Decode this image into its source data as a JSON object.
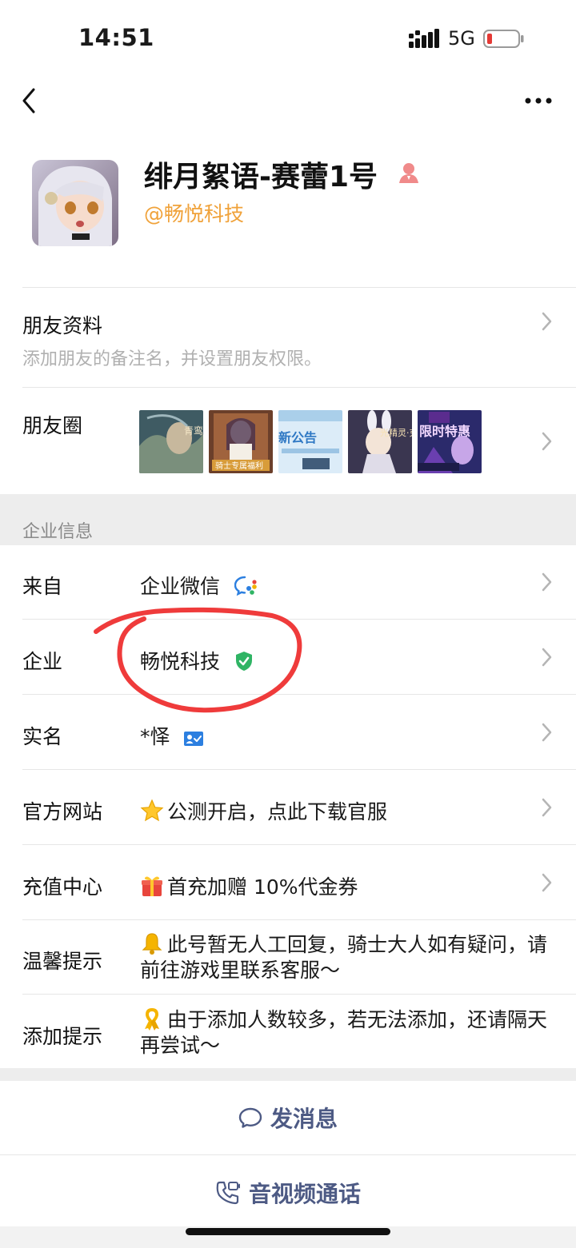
{
  "status_bar": {
    "time": "14:51",
    "network": "5G"
  },
  "profile": {
    "name": "绯月絮语-赛蕾1号",
    "company": "@畅悦科技"
  },
  "friend_info": {
    "title": "朋友资料",
    "subtitle": "添加朋友的备注名，并设置朋友权限。"
  },
  "moments": {
    "title": "朋友圈",
    "thumbnails": [
      "青鸾",
      "骑士专属福利",
      "新公告",
      "光精灵·克",
      "限时特惠"
    ]
  },
  "enterprise": {
    "section_title": "企业信息",
    "rows": [
      {
        "label": "来自",
        "value": "企业微信"
      },
      {
        "label": "企业",
        "value": "畅悦科技"
      },
      {
        "label": "实名",
        "value": "*怿"
      },
      {
        "label": "官方网站",
        "value": "公测开启，点此下载官服",
        "emoji": "star-icon"
      },
      {
        "label": "充值中心",
        "value": "首充加赠 10%代金券",
        "emoji": "gift-icon"
      },
      {
        "label": "温馨提示",
        "value": "此号暂无人工回复，骑士大人如有疑问，请前往游戏里联系客服～",
        "emoji": "bell-icon"
      },
      {
        "label": "添加提示",
        "value": "由于添加人数较多，若无法添加，还请隔天再尝试～",
        "emoji": "ribbon-icon"
      }
    ]
  },
  "actions": {
    "message": "发消息",
    "call": "音视频通话"
  },
  "colors": {
    "accent_orange": "#f0a23a",
    "action_text": "#4d5a84",
    "verified_green": "#2fb464",
    "annotation_red": "#ef3b3b"
  }
}
